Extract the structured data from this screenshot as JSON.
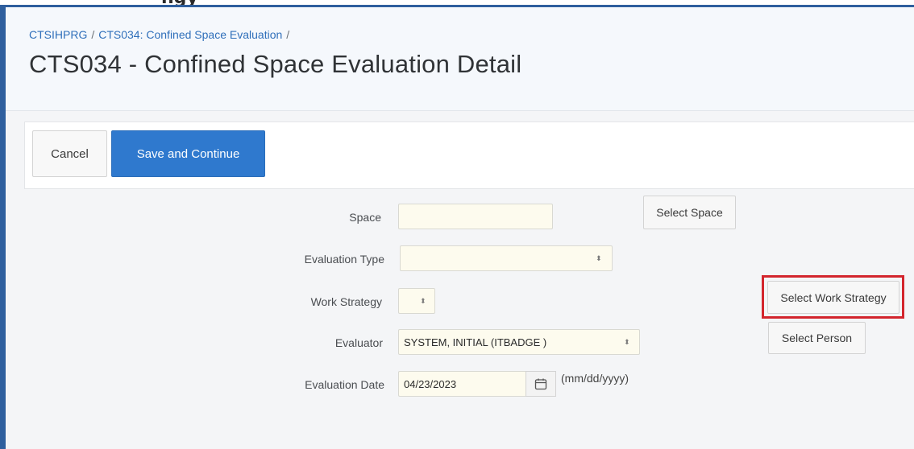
{
  "top_cut_text": "ngy",
  "breadcrumb": {
    "items": [
      "CTSIHPRG",
      "CTS034: Confined Space Evaluation"
    ],
    "separator": "/"
  },
  "page_title": "CTS034 - Confined Space Evaluation Detail",
  "toolbar": {
    "cancel_label": "Cancel",
    "save_label": "Save and Continue"
  },
  "form": {
    "space": {
      "label": "Space",
      "value": "",
      "button": "Select Space"
    },
    "evaluation_type": {
      "label": "Evaluation Type",
      "value": ""
    },
    "work_strategy": {
      "label": "Work Strategy",
      "value": "",
      "button": "Select Work Strategy"
    },
    "evaluator": {
      "label": "Evaluator",
      "value": "SYSTEM, INITIAL (ITBADGE )",
      "button": "Select Person"
    },
    "evaluation_date": {
      "label": "Evaluation Date",
      "value": "04/23/2023",
      "hint": "(mm/dd/yyyy)"
    }
  },
  "colors": {
    "accent": "#2f79ce",
    "highlight": "#d3252d",
    "field_bg": "#fdfbee"
  },
  "icons": {
    "select_caret": "up-down-caret-icon",
    "calendar": "calendar-icon"
  }
}
